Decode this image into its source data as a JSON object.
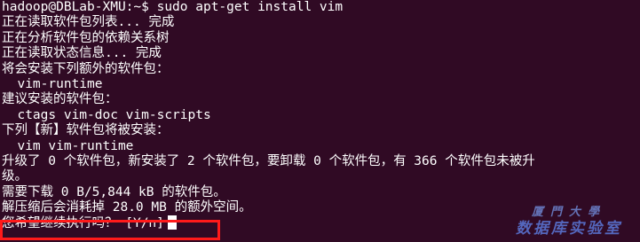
{
  "terminal": {
    "lines": [
      "hadoop@DBLab-XMU:~$ sudo apt-get install vim",
      "正在读取软件包列表... 完成",
      "正在分析软件包的依赖关系树",
      "正在读取状态信息... 完成",
      "将会安装下列额外的软件包：",
      "  vim-runtime",
      "建议安装的软件包：",
      "  ctags vim-doc vim-scripts",
      "下列【新】软件包将被安装：",
      "  vim vim-runtime",
      "升级了 0 个软件包，新安装了 2 个软件包，要卸载 0 个软件包，有 366 个软件包未被升",
      "级。",
      "需要下载 0 B/5,844 kB 的软件包。",
      "解压缩后会消耗掉 28.0 MB 的额外空间。"
    ],
    "prompt": "您希望继续执行吗？ [Y/n]"
  },
  "watermark": {
    "top": "厦門大學",
    "bottom": "数据库实验室"
  },
  "colors": {
    "background": "#300a24",
    "text": "#ffffff",
    "highlight_border": "#ff1a1a"
  }
}
